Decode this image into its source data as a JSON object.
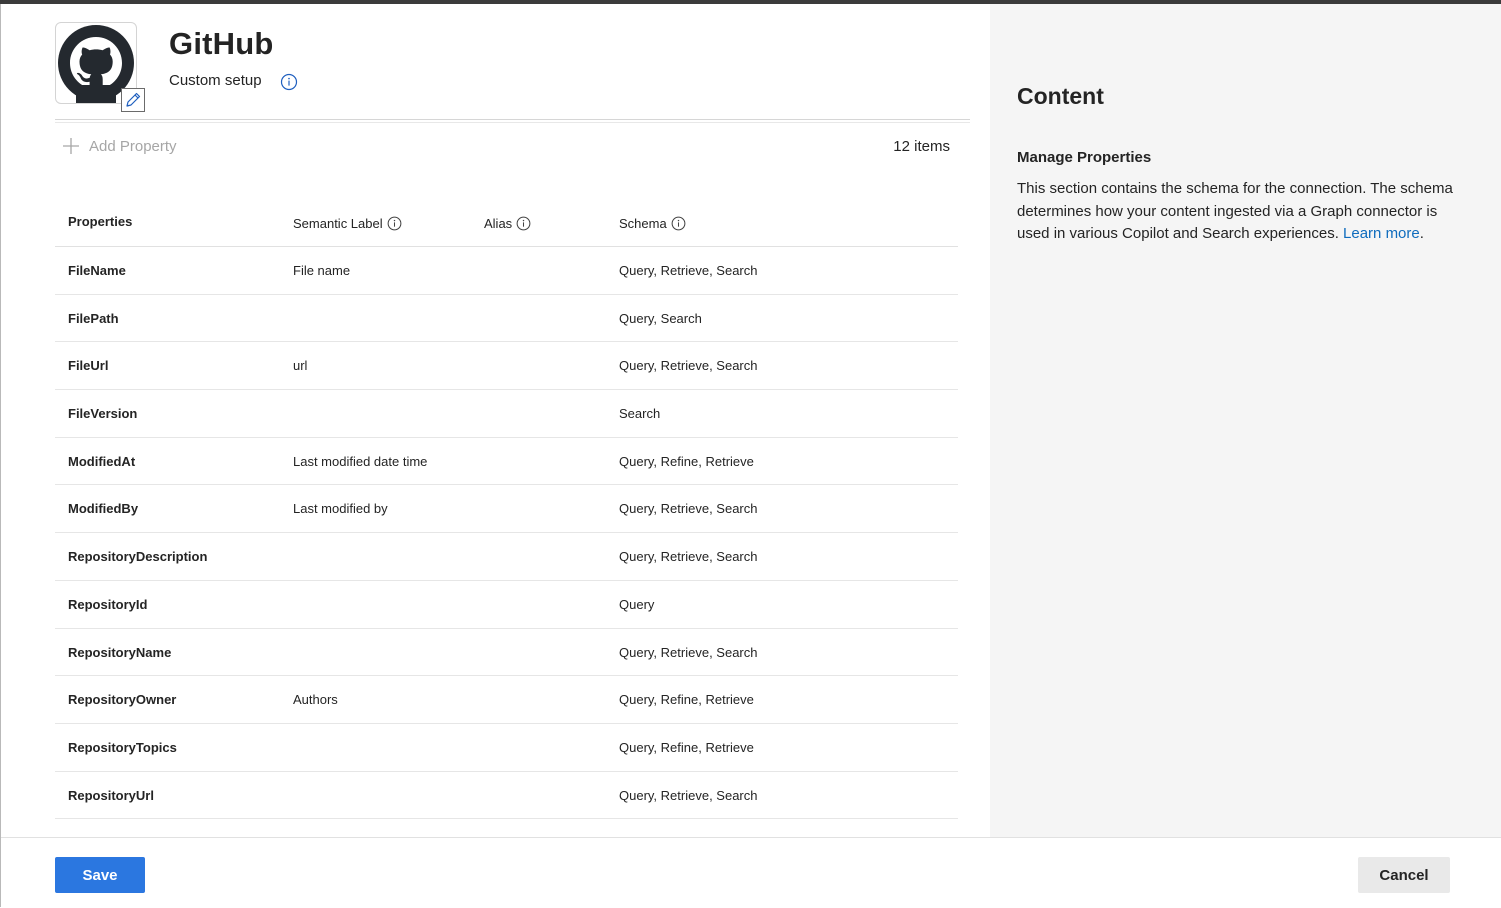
{
  "header": {
    "title": "GitHub",
    "subtitle": "Custom setup",
    "logo_icon": "github-octocat-logo",
    "edit_icon": "pencil-icon"
  },
  "toolbar": {
    "add_label": "Add Property",
    "items_count": "12 items"
  },
  "table": {
    "columns": {
      "properties": "Properties",
      "semantic_label": "Semantic Label",
      "alias": "Alias",
      "schema": "Schema"
    },
    "rows": [
      {
        "property": "FileName",
        "semantic_label": "File name",
        "alias": "",
        "schema": "Query, Retrieve, Search"
      },
      {
        "property": "FilePath",
        "semantic_label": "",
        "alias": "",
        "schema": "Query, Search"
      },
      {
        "property": "FileUrl",
        "semantic_label": "url",
        "alias": "",
        "schema": "Query, Retrieve, Search"
      },
      {
        "property": "FileVersion",
        "semantic_label": "",
        "alias": "",
        "schema": "Search"
      },
      {
        "property": "ModifiedAt",
        "semantic_label": "Last modified date time",
        "alias": "",
        "schema": "Query, Refine, Retrieve"
      },
      {
        "property": "ModifiedBy",
        "semantic_label": "Last modified by",
        "alias": "",
        "schema": "Query, Retrieve, Search"
      },
      {
        "property": "RepositoryDescription",
        "semantic_label": "",
        "alias": "",
        "schema": "Query, Retrieve, Search"
      },
      {
        "property": "RepositoryId",
        "semantic_label": "",
        "alias": "",
        "schema": "Query"
      },
      {
        "property": "RepositoryName",
        "semantic_label": "",
        "alias": "",
        "schema": "Query, Retrieve, Search"
      },
      {
        "property": "RepositoryOwner",
        "semantic_label": "Authors",
        "alias": "",
        "schema": "Query, Refine, Retrieve"
      },
      {
        "property": "RepositoryTopics",
        "semantic_label": "",
        "alias": "",
        "schema": "Query, Refine, Retrieve"
      },
      {
        "property": "RepositoryUrl",
        "semantic_label": "",
        "alias": "",
        "schema": "Query, Retrieve, Search"
      }
    ]
  },
  "side_panel": {
    "title": "Content",
    "subtitle": "Manage Properties",
    "description": "This section contains the schema for the connection. The schema determines how your content ingested via a Graph connector is used in various Copilot and Search experiences.",
    "link_text": "Learn more",
    "link_suffix": "."
  },
  "footer": {
    "save_label": "Save",
    "cancel_label": "Cancel"
  },
  "colors": {
    "primary": "#2b77e0",
    "link": "#0f6cbd",
    "side_bg": "#f5f5f5",
    "info_icon": "#1f5fbf"
  }
}
